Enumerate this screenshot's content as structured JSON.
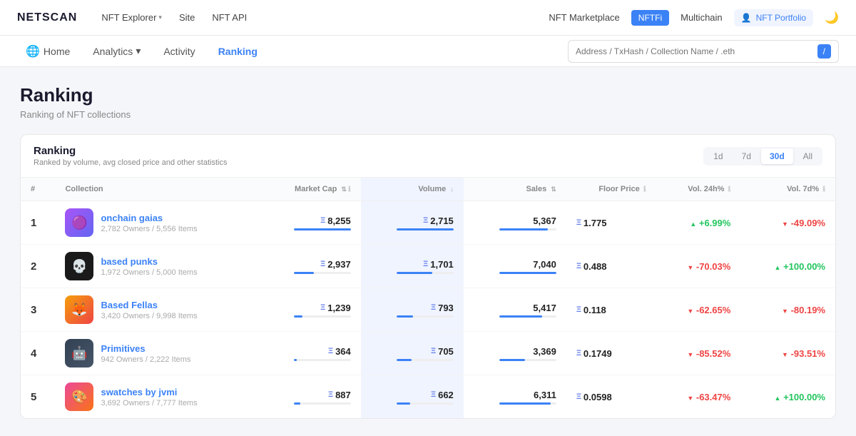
{
  "topNav": {
    "logo": "NETSCAN",
    "links": [
      {
        "label": "NFT Explorer",
        "hasChevron": true
      },
      {
        "label": "Site"
      },
      {
        "label": "NFT API"
      }
    ],
    "rightLinks": [
      {
        "label": "NFT Marketplace"
      },
      {
        "label": "NFTFi",
        "highlight": true
      },
      {
        "label": "Multichain"
      }
    ],
    "portfolio": "NFT Portfolio",
    "searchPlaceholder": "Address / TxHash / Collection Name / .eth"
  },
  "subNav": {
    "items": [
      {
        "label": "Home",
        "icon": "🏠",
        "active": false
      },
      {
        "label": "Analytics",
        "hasChevron": true,
        "active": false
      },
      {
        "label": "Activity",
        "active": false
      },
      {
        "label": "Ranking",
        "active": true
      }
    ]
  },
  "page": {
    "title": "Ranking",
    "subtitle": "Ranking of NFT collections"
  },
  "rankingCard": {
    "title": "Ranking",
    "subtitle": "Ranked by volume, avg closed price and other statistics",
    "periods": [
      {
        "label": "1d",
        "active": false
      },
      {
        "label": "7d",
        "active": false
      },
      {
        "label": "30d",
        "active": true
      },
      {
        "label": "All",
        "active": false
      }
    ],
    "columns": [
      {
        "label": "#",
        "key": "rank"
      },
      {
        "label": "Collection",
        "key": "collection"
      },
      {
        "label": "Market Cap",
        "key": "marketCap",
        "sortable": true,
        "info": true
      },
      {
        "label": "Volume",
        "key": "volume",
        "sortable": true,
        "highlight": true
      },
      {
        "label": "Sales",
        "key": "sales",
        "sortable": true
      },
      {
        "label": "Floor Price",
        "key": "floorPrice",
        "info": true
      },
      {
        "label": "Vol. 24h%",
        "key": "vol24h",
        "info": true
      },
      {
        "label": "Vol. 7d%",
        "key": "vol7d",
        "info": true
      }
    ],
    "rows": [
      {
        "rank": "1",
        "name": "onchain gaias",
        "owners": "2,782 Owners",
        "items": "5,556 Items",
        "avatarClass": "avatar-1",
        "avatarEmoji": "🟣",
        "marketCap": "8,255",
        "marketCapBar": 100,
        "volume": "2,715",
        "volumeBar": 100,
        "sales": "5,367",
        "salesBar": 85,
        "floorPrice": "1.775",
        "vol24h": "+6.99%",
        "vol24hPositive": true,
        "vol7d": "-49.09%",
        "vol7dPositive": false
      },
      {
        "rank": "2",
        "name": "based punks",
        "owners": "1,972 Owners",
        "items": "5,000 Items",
        "avatarClass": "avatar-2",
        "avatarEmoji": "💀",
        "marketCap": "2,937",
        "marketCapBar": 35,
        "volume": "1,701",
        "volumeBar": 63,
        "sales": "7,040",
        "salesBar": 100,
        "floorPrice": "0.488",
        "vol24h": "-70.03%",
        "vol24hPositive": false,
        "vol7d": "+100.00%",
        "vol7dPositive": true
      },
      {
        "rank": "3",
        "name": "Based Fellas",
        "owners": "3,420 Owners",
        "items": "9,998 Items",
        "avatarClass": "avatar-3",
        "avatarEmoji": "🦊",
        "marketCap": "1,239",
        "marketCapBar": 15,
        "volume": "793",
        "volumeBar": 29,
        "sales": "5,417",
        "salesBar": 75,
        "floorPrice": "0.118",
        "vol24h": "-62.65%",
        "vol24hPositive": false,
        "vol7d": "-80.19%",
        "vol7dPositive": false
      },
      {
        "rank": "4",
        "name": "Primitives",
        "owners": "942 Owners",
        "items": "2,222 Items",
        "avatarClass": "avatar-4",
        "avatarEmoji": "🤖",
        "marketCap": "364",
        "marketCapBar": 5,
        "volume": "705",
        "volumeBar": 26,
        "sales": "3,369",
        "salesBar": 45,
        "floorPrice": "0.1749",
        "vol24h": "-85.52%",
        "vol24hPositive": false,
        "vol7d": "-93.51%",
        "vol7dPositive": false
      },
      {
        "rank": "5",
        "name": "swatches by jvmi",
        "owners": "3,692 Owners",
        "items": "7,777 Items",
        "avatarClass": "avatar-5",
        "avatarEmoji": "🎨",
        "marketCap": "887",
        "marketCapBar": 11,
        "volume": "662",
        "volumeBar": 24,
        "sales": "6,311",
        "salesBar": 90,
        "floorPrice": "0.0598",
        "vol24h": "-63.47%",
        "vol24hPositive": false,
        "vol7d": "+100.00%",
        "vol7dPositive": true
      }
    ]
  }
}
